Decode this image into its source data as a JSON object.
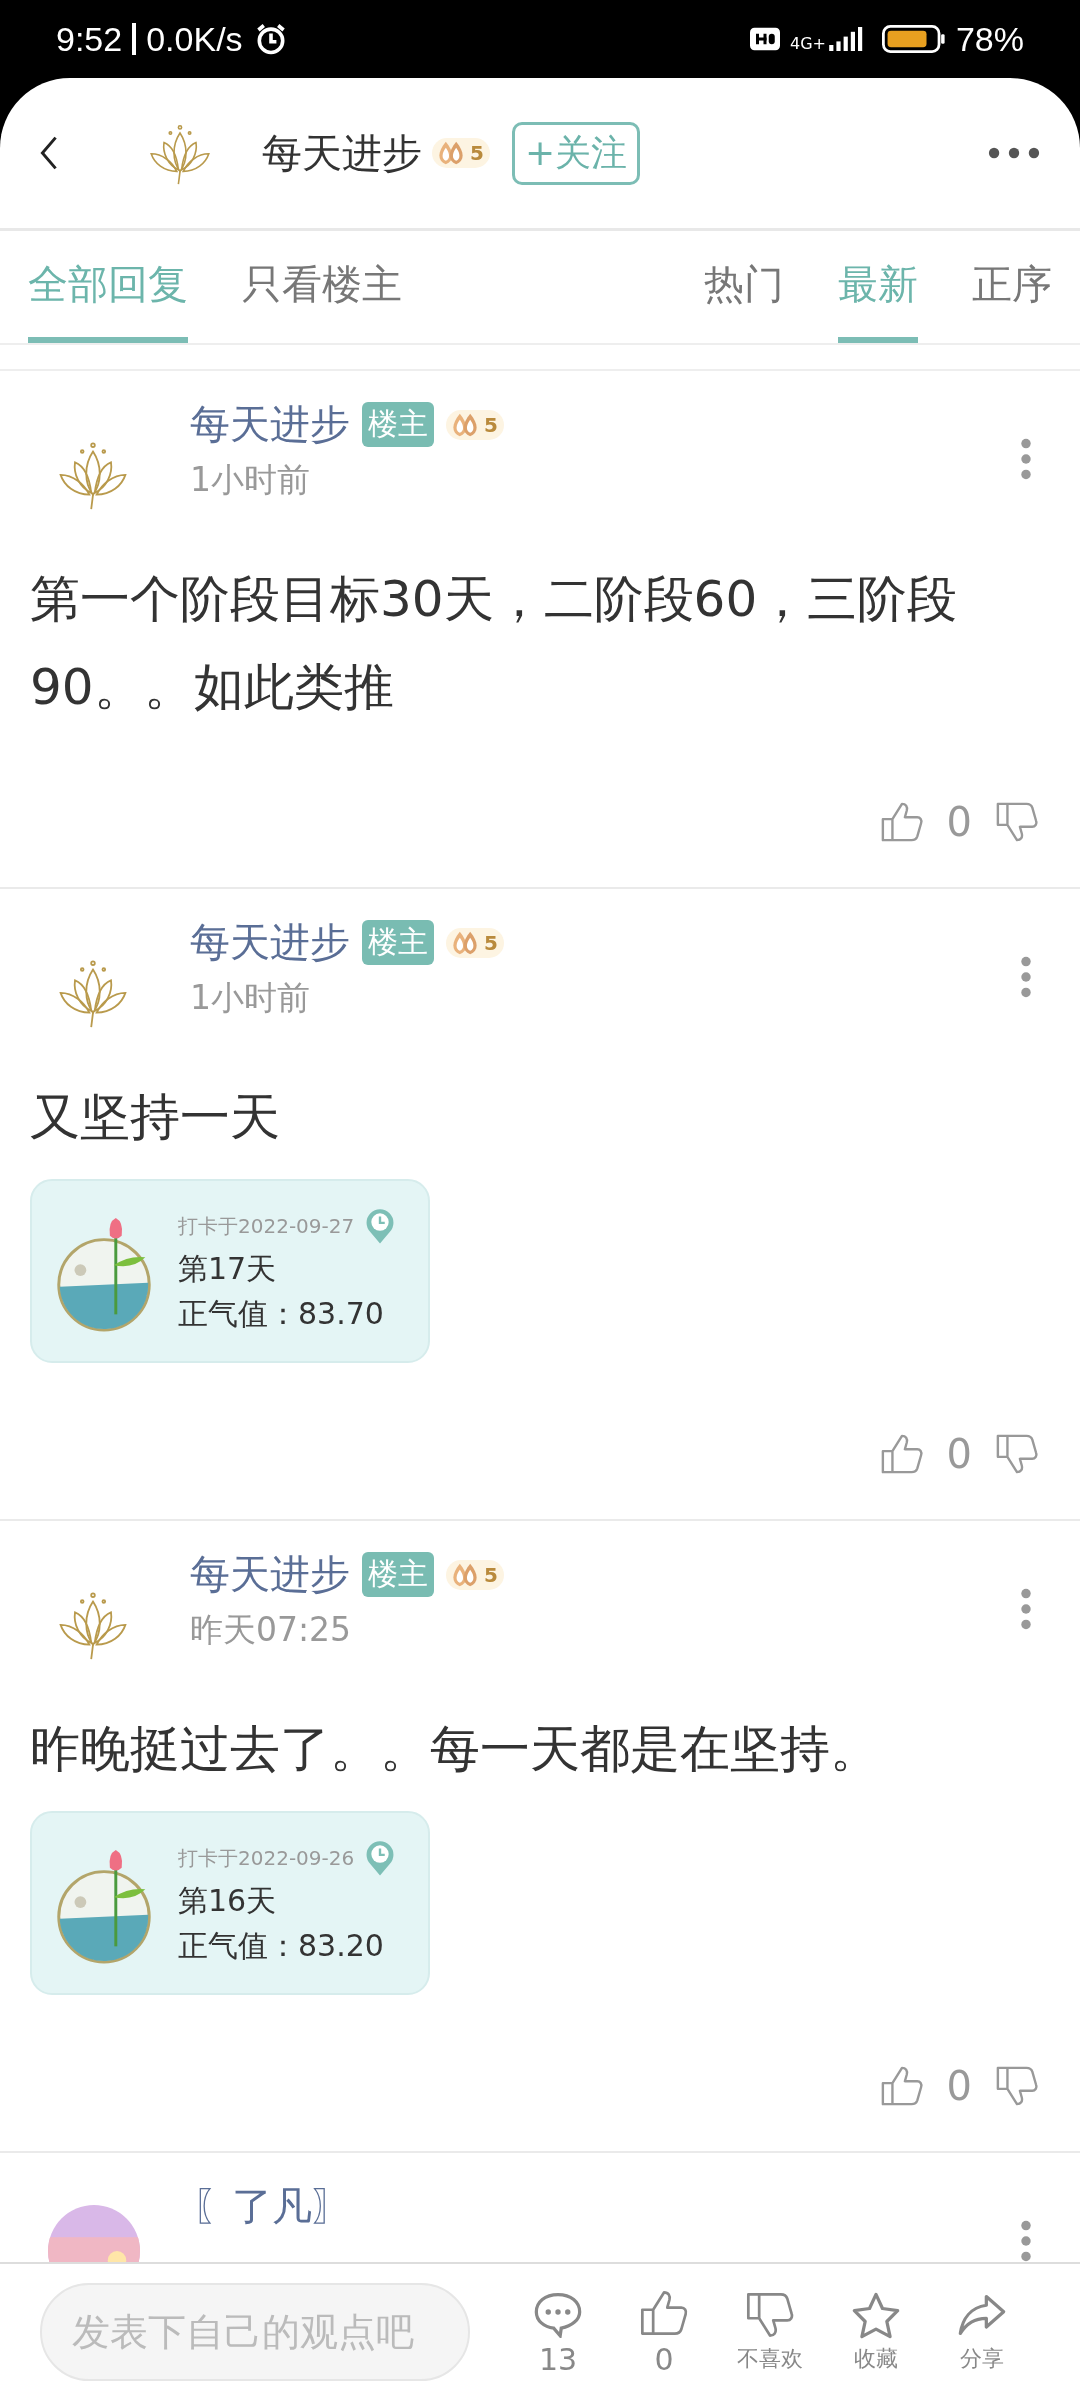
{
  "status_bar": {
    "time": "9:52",
    "speed": "0.0K/s",
    "network": "4G+",
    "battery": "78%"
  },
  "header": {
    "title": "每天进步",
    "level": "5",
    "follow_button": "+关注"
  },
  "tabs": [
    {
      "label": "全部回复",
      "selected": true
    },
    {
      "label": "只看楼主",
      "selected": false
    }
  ],
  "sort_tabs": [
    {
      "label": "热门",
      "selected": false
    },
    {
      "label": "最新",
      "selected": true
    },
    {
      "label": "正序",
      "selected": false
    }
  ],
  "posts": [
    {
      "avatar": {
        "kind": "lotus"
      },
      "author": "每天进步",
      "badge": "楼主",
      "level": "5",
      "time": "1小时前",
      "content": "第一个阶段目标30天，二阶段60，三阶段90。。如此类推",
      "likes": "0"
    },
    {
      "avatar": {
        "kind": "lotus"
      },
      "author": "每天进步",
      "badge": "楼主",
      "level": "5",
      "time": "1小时前",
      "content": "又坚持一天",
      "checkin": {
        "date": "打卡于2022-09-27",
        "day": "第17天",
        "value": "正气值：83.70"
      },
      "likes": "0"
    },
    {
      "avatar": {
        "kind": "lotus"
      },
      "author": "每天进步",
      "badge": "楼主",
      "level": "5",
      "time": "昨天07:25",
      "content": "昨晚挺过去了。。每一天都是在坚持。",
      "checkin": {
        "date": "打卡于2022-09-26",
        "day": "第16天",
        "value": "正气值：83.20"
      },
      "likes": "0"
    },
    {
      "author": "〖了凡〗"
    }
  ],
  "bottom_bar": {
    "placeholder": "发表下自己的观点吧",
    "actions": [
      {
        "kind": "comment",
        "label": "13"
      },
      {
        "kind": "like",
        "label": "0"
      },
      {
        "kind": "dislike",
        "label": "不喜欢"
      },
      {
        "kind": "star",
        "label": "收藏"
      },
      {
        "kind": "share",
        "label": "分享"
      }
    ]
  }
}
